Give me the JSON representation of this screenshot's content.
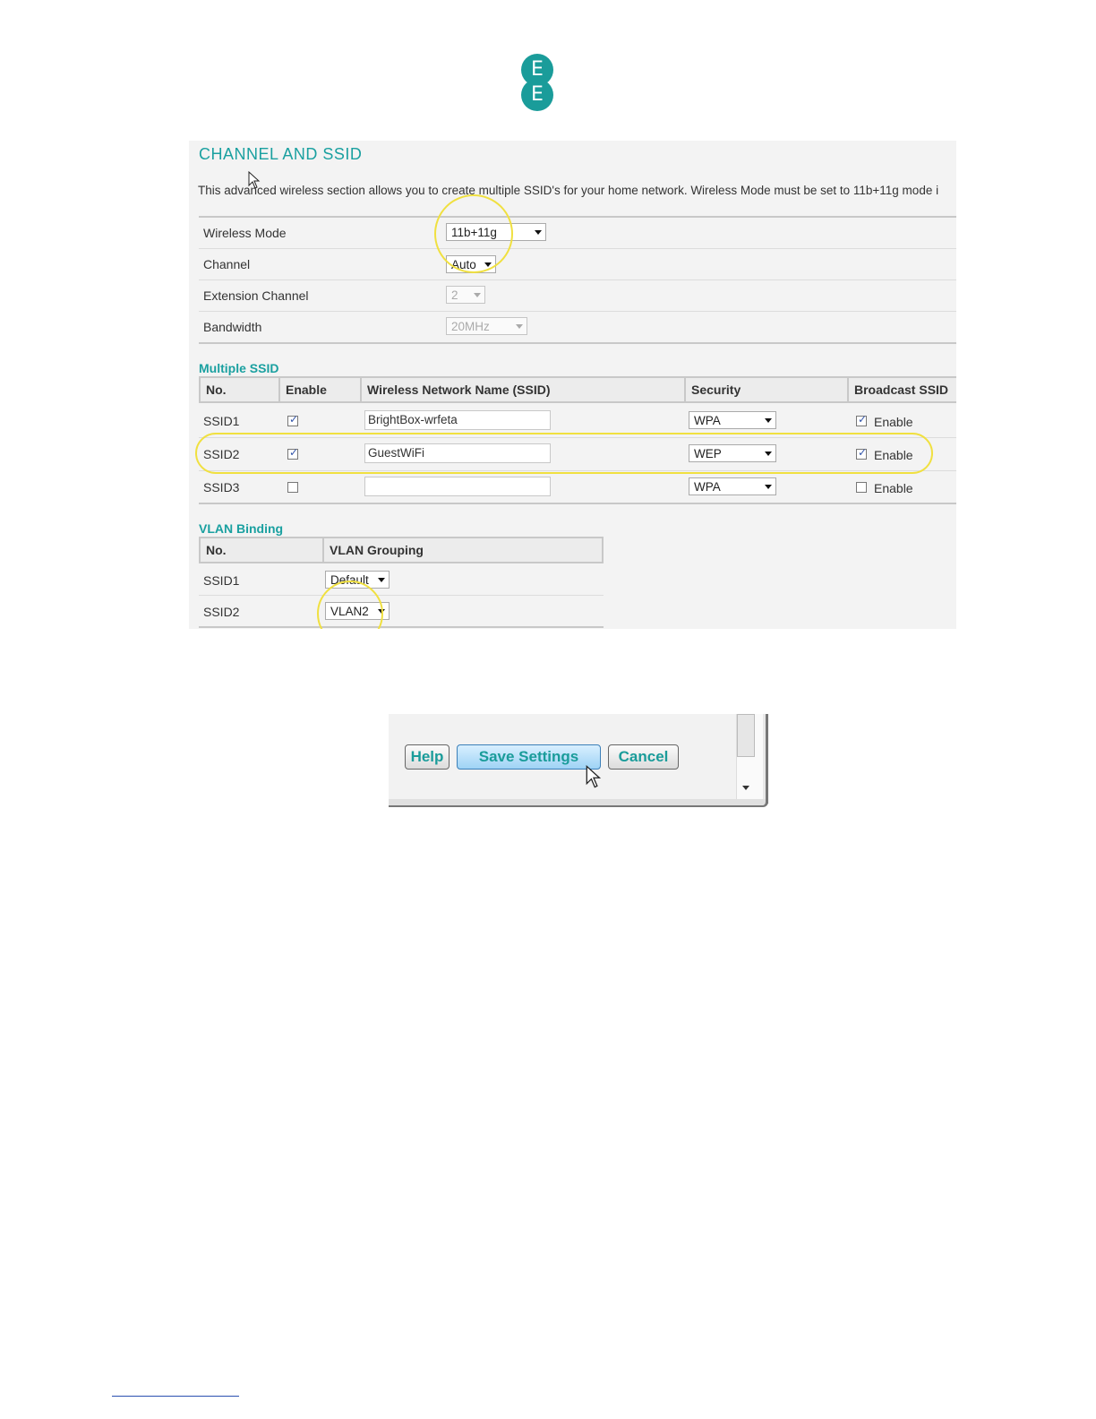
{
  "logo": {
    "letter_top": "E",
    "letter_bottom": "E"
  },
  "panel": {
    "title": "CHANNEL AND SSID",
    "description": "This advanced wireless section allows you to create multiple SSID's for your home network. Wireless Mode must be set to 11b+11g mode i",
    "settings": [
      {
        "label": "Wireless Mode",
        "value": "11b+11g",
        "disabled": false
      },
      {
        "label": "Channel",
        "value": "Auto",
        "disabled": false
      },
      {
        "label": "Extension Channel",
        "value": "2",
        "disabled": true
      },
      {
        "label": "Bandwidth",
        "value": "20MHz",
        "disabled": true
      }
    ]
  },
  "multiple_ssid": {
    "heading": "Multiple SSID",
    "columns": [
      "No.",
      "Enable",
      "Wireless Network Name (SSID)",
      "Security",
      "Broadcast SSID"
    ],
    "rows": [
      {
        "no": "SSID1",
        "enabled": true,
        "name": "BrightBox-wrfeta",
        "security": "WPA",
        "broadcast": true,
        "broadcast_label": "Enable"
      },
      {
        "no": "SSID2",
        "enabled": true,
        "name": "GuestWiFi",
        "security": "WEP",
        "broadcast": true,
        "broadcast_label": "Enable"
      },
      {
        "no": "SSID3",
        "enabled": false,
        "name": "",
        "security": "WPA",
        "broadcast": false,
        "broadcast_label": "Enable"
      }
    ]
  },
  "vlan_binding": {
    "heading": "VLAN Binding",
    "columns": [
      "No.",
      "VLAN Grouping"
    ],
    "rows": [
      {
        "no": "SSID1",
        "group": "Default"
      },
      {
        "no": "SSID2",
        "group": "VLAN2"
      }
    ]
  },
  "buttons": {
    "help": "Help",
    "save": "Save Settings",
    "cancel": "Cancel"
  },
  "icons": {
    "checkmark": "check-icon",
    "dropdown": "chevron-down-icon",
    "cursor": "mouse-pointer-icon"
  },
  "colors": {
    "brand_teal": "#1aa0a0",
    "highlight_yellow": "#f0e040"
  }
}
